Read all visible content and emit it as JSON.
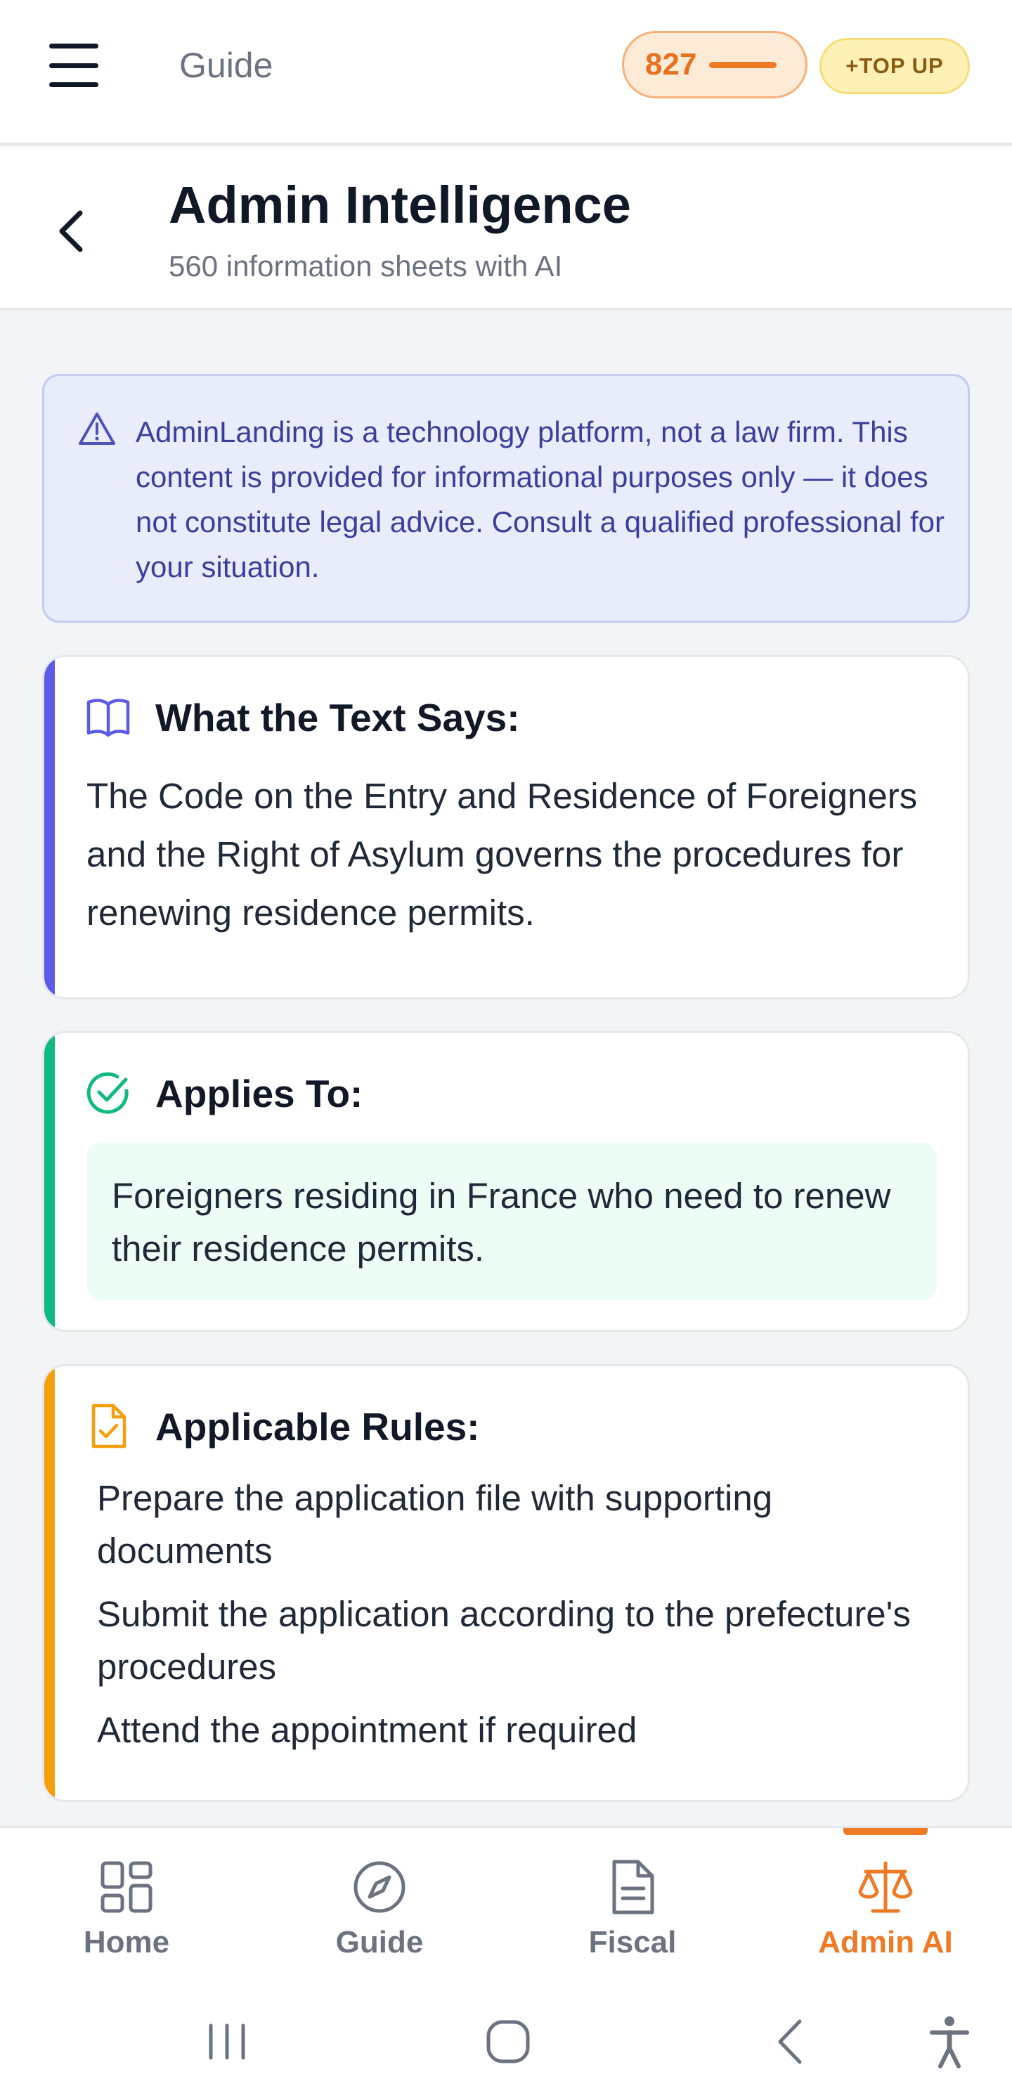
{
  "topbar": {
    "title": "Guide",
    "credits": "827",
    "topup_label": "+TOP UP"
  },
  "header": {
    "title": "Admin Intelligence",
    "subtitle": "560 information sheets with AI"
  },
  "disclaimer": {
    "text": "AdminLanding is a technology platform, not a law firm. This content is provided for informational purposes only — it does not constitute legal advice. Consult a qualified professional for your situation."
  },
  "sections": {
    "text_says": {
      "title": "What the Text Says:",
      "body": "The Code on the Entry and Residence of Foreigners and the Right of Asylum governs the procedures for renewing residence permits."
    },
    "applies_to": {
      "title": "Applies To:",
      "body": "Foreigners residing in France who need to renew their residence permits."
    },
    "rules": {
      "title": "Applicable Rules:",
      "items": [
        "Prepare the application file with supporting documents",
        "Submit the application according to the prefecture's procedures",
        "Attend the appointment if required"
      ]
    }
  },
  "bottom_nav": {
    "items": [
      {
        "label": "Home",
        "icon": "grid-icon"
      },
      {
        "label": "Guide",
        "icon": "compass-icon"
      },
      {
        "label": "Fiscal",
        "icon": "document-icon"
      },
      {
        "label": "Admin AI",
        "icon": "scales-icon",
        "active": true
      }
    ]
  },
  "colors": {
    "accent_orange": "#ee7a25",
    "text_says_accent": "#5b5be8",
    "applies_accent": "#10b981",
    "rules_accent": "#f59e0b",
    "disclaimer_text": "#3b3f9a"
  }
}
